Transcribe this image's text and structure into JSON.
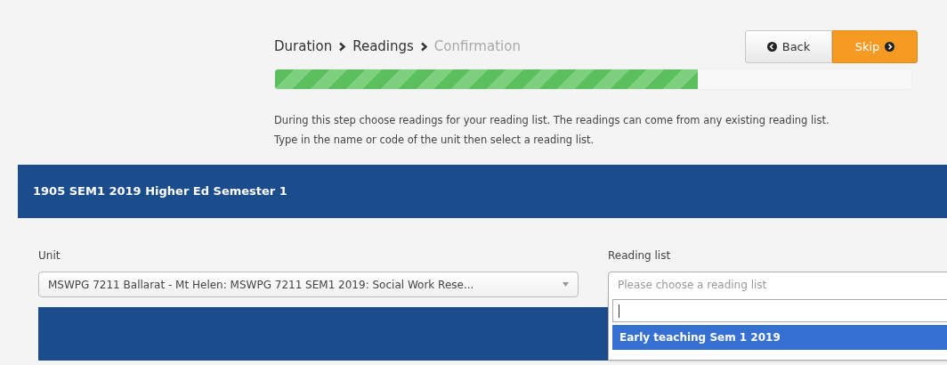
{
  "breadcrumb": [
    {
      "label": "Duration",
      "disabled": false
    },
    {
      "label": "Readings",
      "disabled": false
    },
    {
      "label": "Confirmation",
      "disabled": true
    }
  ],
  "buttons": [
    {
      "label": "Back",
      "kind": "back"
    },
    {
      "label": "Skip",
      "kind": "next"
    }
  ],
  "progress": {
    "level": 0.665
  },
  "description": [
    "During this step choose readings for your reading list. The readings can come from any existing reading list.",
    "Type in the name or code of the unit then select a reading list."
  ],
  "section": {
    "title": "1905 SEM1 2019 Higher Ed Semester 1"
  },
  "unit": {
    "label": "Unit",
    "value": "MSWPG 7211 Ballarat - Mt Helen: MSWPG 7211 SEM1 2019: Social Work Rese..."
  },
  "reading_list": {
    "label": "Reading list",
    "placeholder": "Please choose a reading list",
    "expanded": true,
    "options": [
      {
        "label": "Early teaching Sem 1 2019",
        "selected": true
      }
    ]
  }
}
